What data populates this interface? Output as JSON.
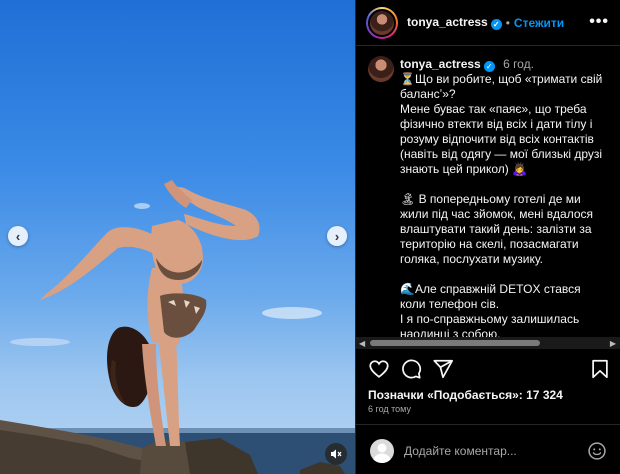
{
  "header": {
    "username": "tonya_actress",
    "follow_label": "Стежити",
    "more_glyph": "•••"
  },
  "caption": {
    "username": "tonya_actress",
    "time": "6 год.",
    "text": "⏳Що ви робите, щоб «тримати свій балансʼ»?\nМене буває так «паяє», що треба фізично втекти від всіх і дати тілу і розуму відпочити від всіх контактів (навіть від одягу — мої близькі друзі знають цей прикол) 🙇‍♀️\n\n🏝 В попередньому готелі де ми жили під час зйомок, мені вдалося влаштувати такий день: залізти за територію на скелі, позасмагати голяка, послухати музику.\n\n🌊Але справжній DETOX стався коли телефон сів.\nІ я по-справжньому залишилась наодинці з собою.\nХочеш не хочеш прийдеться"
  },
  "likes": {
    "text": "Позначки «Подобається»: 17 324"
  },
  "posted_ago": "6 год тому",
  "comment": {
    "placeholder": "Додайте коментар..."
  },
  "icons": {
    "verified": "verified-badge-icon",
    "like": "heart-icon",
    "comment": "comment-icon",
    "share": "share-icon",
    "save": "bookmark-icon",
    "emoji": "emoji-icon",
    "mute": "muted-speaker-icon",
    "prev": "chevron-left-icon",
    "next": "chevron-right-icon"
  },
  "colors": {
    "accent": "#0095f6",
    "background": "#000000",
    "text": "#f5f5f5",
    "muted": "#a8a8a8"
  }
}
